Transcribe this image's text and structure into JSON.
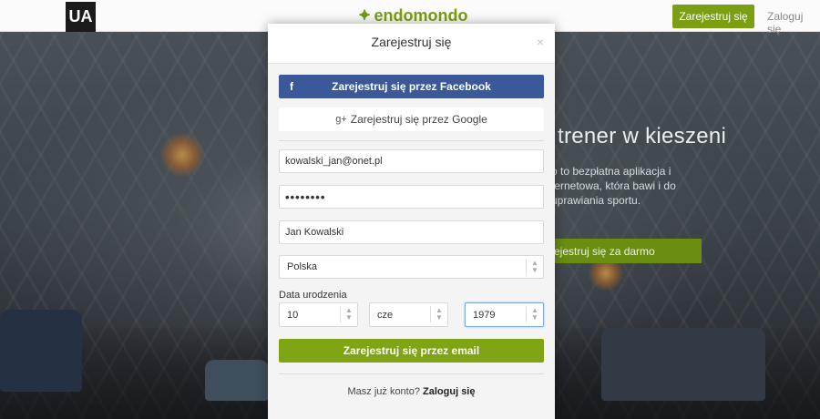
{
  "header": {
    "ua_logo": "UA",
    "brand_mark": "⯌",
    "brand_name": "endomondo",
    "register_label": "Zarejestruj się",
    "login_label": "Zaloguj się"
  },
  "hero": {
    "title": "trener w kieszeni",
    "description": "o to bezpłatna aplikacja i ternetowa, która bawi i do uprawiania sportu.",
    "cta_label": "ejestruj się za darmo"
  },
  "modal": {
    "title": "Zarejestruj się",
    "close": "×",
    "facebook_icon": "f",
    "facebook_label": "Zarejestruj się przez Facebook",
    "google_icon": "g+",
    "google_label": "Zarejestruj się przez Google",
    "email_value": "kowalski_jan@onet.pl",
    "password_value": "••••••••",
    "name_value": "Jan Kowalski",
    "country_value": "Polska",
    "dob_label": "Data urodzenia",
    "dob_day": "10",
    "dob_month": "cze",
    "dob_year": "1979",
    "email_register_label": "Zarejestruj się przez email",
    "footer_question": "Masz już konto?",
    "footer_login": "Zaloguj się"
  },
  "colors": {
    "brand_green": "#7aa012",
    "facebook_blue": "#3b5998"
  },
  "icons": {
    "stepper": "up-down-chevron-icon"
  }
}
